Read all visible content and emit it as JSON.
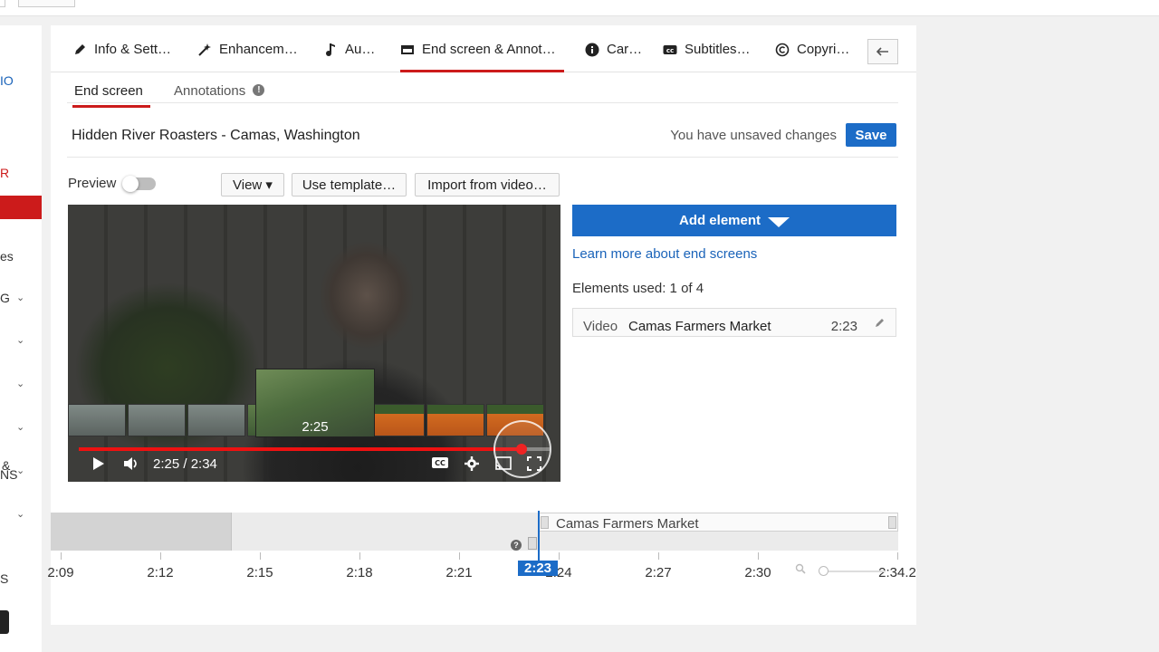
{
  "sidebar": {
    "fragments": [
      "IO",
      "R",
      "es",
      "G",
      "&",
      "NS",
      "S"
    ],
    "chevron": "⌄"
  },
  "tabs": [
    {
      "label": "Info & Sett…",
      "icon": "pencil-icon"
    },
    {
      "label": "Enhancem…",
      "icon": "magic-wand-icon"
    },
    {
      "label": "Au…",
      "icon": "music-note-icon"
    },
    {
      "label": "End screen & Annot…",
      "icon": "end-screen-icon",
      "active": true
    },
    {
      "label": "Car…",
      "icon": "info-icon"
    },
    {
      "label": "Subtitles…",
      "icon": "cc-icon"
    },
    {
      "label": "Copyri…",
      "icon": "copyright-icon"
    }
  ],
  "subtabs": {
    "end_screen": "End screen",
    "annotations": "Annotations",
    "info_glyph": "!"
  },
  "video": {
    "title": "Hidden River Roasters - Camas, Washington"
  },
  "status": {
    "unsaved": "You have unsaved changes",
    "save": "Save"
  },
  "toolbar": {
    "preview": "Preview",
    "view": "View ▾",
    "use_template": "Use template…",
    "import": "Import from video…"
  },
  "player": {
    "hover_time": "2:25",
    "time": "2:25 / 2:34",
    "progress": 0.94
  },
  "right": {
    "add_element": "Add element",
    "learn_more": "Learn more about end screens",
    "elements_used": "Elements used: 1 of 4",
    "element": {
      "type": "Video",
      "name": "Camas Farmers Market",
      "time": "2:23"
    }
  },
  "timeline": {
    "bar_label": "Camas Farmers Market",
    "help_glyph": "?",
    "playhead_label": "2:23",
    "ticks": [
      "2:09",
      "2:12",
      "2:15",
      "2:18",
      "2:21",
      "2:24",
      "2:27",
      "2:30",
      "2:34.2"
    ]
  }
}
